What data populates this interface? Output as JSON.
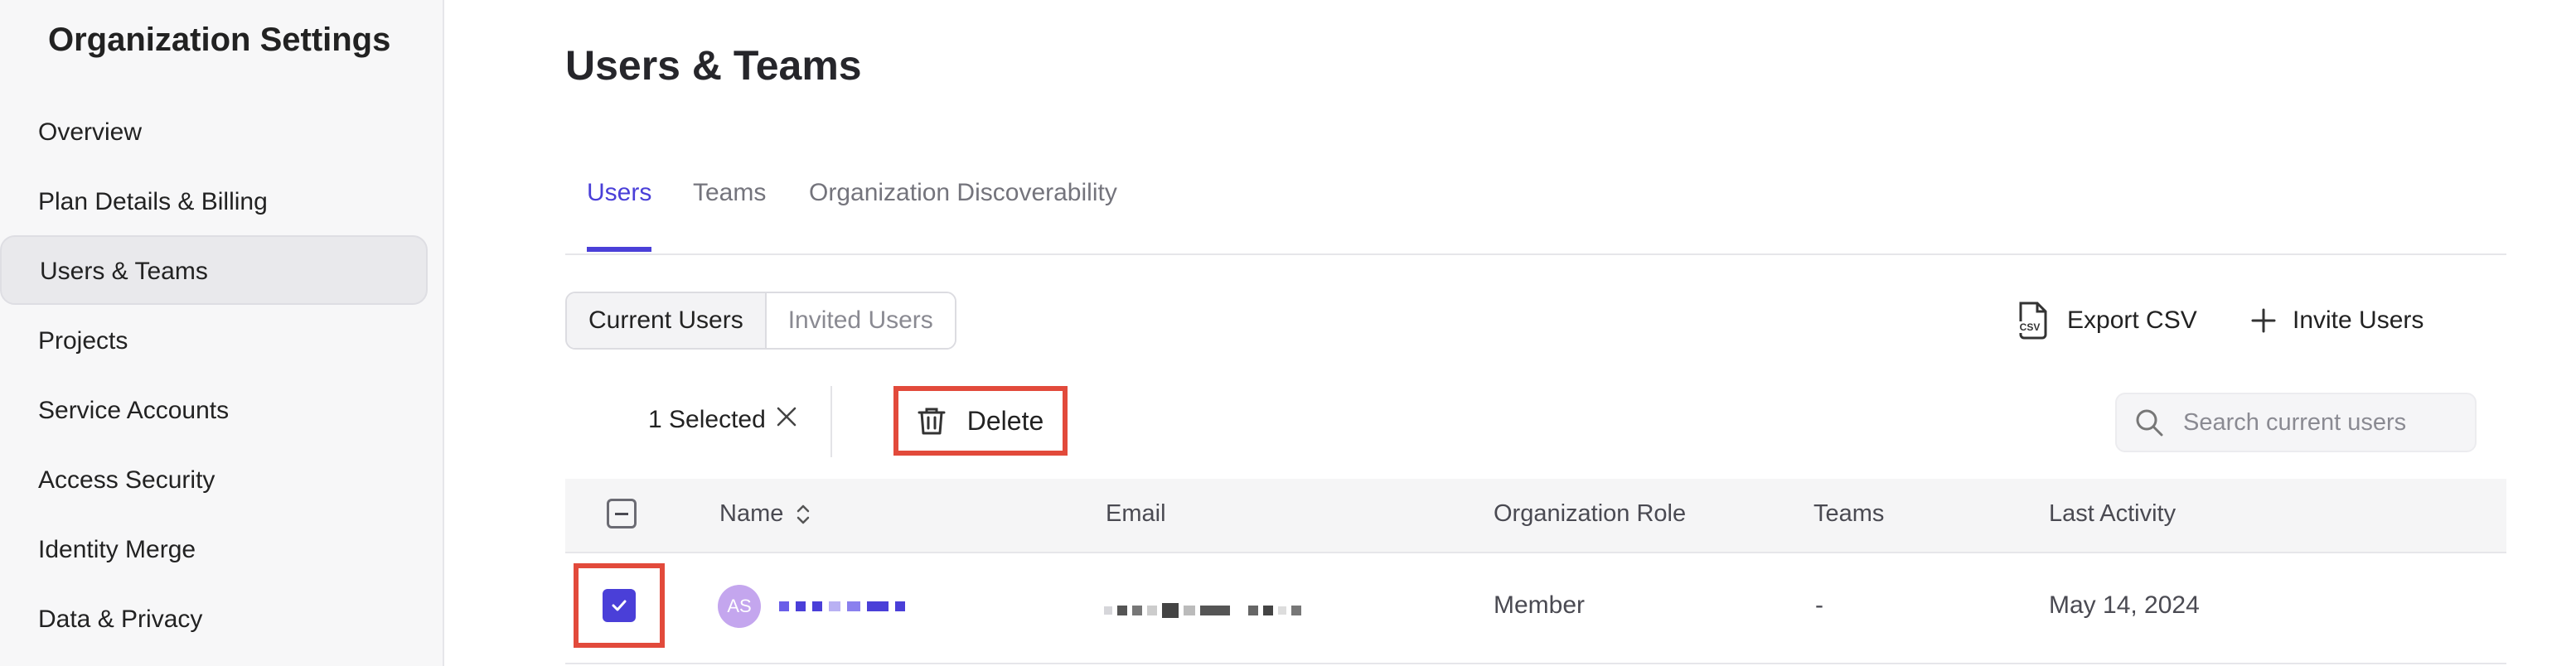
{
  "sidebar": {
    "title": "Organization Settings",
    "items": [
      {
        "label": "Overview",
        "active": false
      },
      {
        "label": "Plan Details & Billing",
        "active": false
      },
      {
        "label": "Users & Teams",
        "active": true
      },
      {
        "label": "Projects",
        "active": false
      },
      {
        "label": "Service Accounts",
        "active": false
      },
      {
        "label": "Access Security",
        "active": false
      },
      {
        "label": "Identity Merge",
        "active": false
      },
      {
        "label": "Data & Privacy",
        "active": false
      }
    ]
  },
  "main": {
    "title": "Users & Teams",
    "tabs": [
      {
        "label": "Users",
        "active": true
      },
      {
        "label": "Teams",
        "active": false
      },
      {
        "label": "Organization Discoverability",
        "active": false
      }
    ],
    "segments": [
      {
        "label": "Current Users",
        "active": true
      },
      {
        "label": "Invited Users",
        "active": false
      }
    ],
    "actions": {
      "export_label": "Export CSV",
      "export_icon": "csv-file-icon",
      "invite_label": "Invite Users",
      "invite_icon": "plus-icon"
    },
    "selection": {
      "count_label": "1 Selected",
      "clear_icon": "close-icon",
      "delete_label": "Delete",
      "delete_icon": "trash-icon"
    },
    "search": {
      "placeholder": "Search current users",
      "icon": "search-icon"
    },
    "table": {
      "columns": [
        "Name",
        "Email",
        "Organization Role",
        "Teams",
        "Last Activity"
      ],
      "sort_icon": "sort-icon",
      "rows": [
        {
          "selected": true,
          "initials": "AS",
          "role": "Member",
          "teams": "-",
          "last_activity": "May 14, 2024"
        }
      ]
    }
  },
  "colors": {
    "accent": "#4a3fd8",
    "highlight": "#e24a3b",
    "avatar": "#c4a6ee",
    "sidebar_bg": "#f7f7f8"
  }
}
